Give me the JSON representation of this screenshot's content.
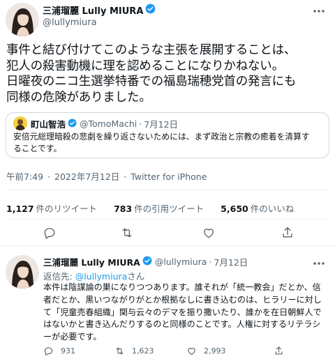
{
  "colors": {
    "accent": "#1d9bf0",
    "muted": "#536471",
    "text": "#0f1419",
    "border": "#cfd9de"
  },
  "main_tweet": {
    "author": {
      "display_name": "三浦瑠麗 Lully MIURA",
      "handle": "@lullymiura",
      "verified_icon": "verified-badge-icon"
    },
    "text_lines": [
      "事件と結び付けてこのような主張を展開することは、",
      "犯人の殺害動機に理を認めることになりかねない。",
      "日曜夜のニコ生選挙特番での福島瑞穂党首の発言にも",
      "同様の危険がありました。"
    ],
    "quoted_tweet": {
      "display_name": "町山智浩",
      "verified_icon": "verified-badge-icon",
      "handle": "@TomoMachi",
      "separator": "·",
      "date": "7月12日",
      "text_lines": [
        "安倍元総理暗殺の悲劇を繰り返さないためには、まず政治と宗教の癒着を清算す",
        "ることです。"
      ]
    },
    "meta": {
      "time": "午前7:49",
      "sep": "·",
      "date": "2022年7月12日",
      "source": "Twitter for iPhone"
    },
    "stats": {
      "retweets_count": "1,127",
      "retweets_label": "件のリツイート",
      "quotes_count": "783",
      "quotes_label": "件の引用ツイート",
      "likes_count": "5,650",
      "likes_label": "件のいいね"
    },
    "actions": [
      "reply-icon",
      "retweet-icon",
      "like-icon",
      "share-icon"
    ]
  },
  "reply_tweet": {
    "author": {
      "display_name": "三浦瑠麗 Lully MIURA",
      "handle": "@lullymiura",
      "separator": "·",
      "date": "7月12日"
    },
    "replying_prefix": "返信先: ",
    "replying_handle": "@lullymiura",
    "replying_suffix": "さん",
    "text_lines": [
      "本件は陰謀論の巣になりつつあります。誰それが「統一教会」だとか、信",
      "者だとか、黒いつながりがとか根拠なしに書き込むのは、ヒラリーに対し",
      "て「児童売春組織」関与云々のデマを振り撒いたり、誰かを在日朝鮮人で",
      "はないかと書き込んだりするのと同様のことです。人権に対するリテラシ",
      "ーが必要です。"
    ],
    "counts": {
      "replies": "931",
      "retweets": "1,623",
      "likes": "2,993"
    }
  }
}
